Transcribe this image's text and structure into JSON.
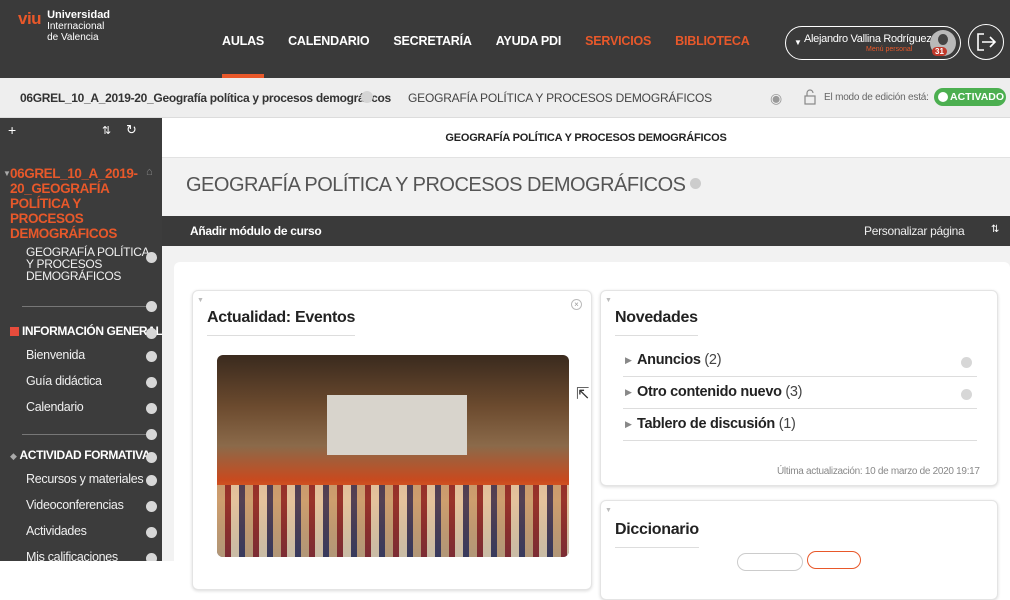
{
  "brand": {
    "mark": "viu",
    "line1": "Universidad",
    "line2": "Internacional",
    "line3": "de Valencia"
  },
  "nav": [
    {
      "label": "AULAS",
      "active": true,
      "color": "#ffffff"
    },
    {
      "label": "CALENDARIO",
      "color": "#ffffff"
    },
    {
      "label": "SECRETARÍA",
      "color": "#ffffff"
    },
    {
      "label": "AYUDA PDI",
      "color": "#ffffff"
    },
    {
      "label": "SERVICIOS",
      "color": "#e8582a"
    },
    {
      "label": "BIBLIOTECA",
      "color": "#e8582a"
    }
  ],
  "user": {
    "name": "Alejandro Vallina Rodríguez",
    "menu_label": "Menú personal",
    "badge": "31"
  },
  "breadcrumb": {
    "course_code": "06GREL_10_A_2019-20_Geografía política y procesos demográficos",
    "current": "GEOGRAFÍA POLÍTICA Y PROCESOS DEMOGRÁFICOS",
    "edit_mode_label": "El modo de edición está:",
    "edit_mode_state": "ACTIVADO"
  },
  "sidebar": {
    "tools": {
      "plus": "+",
      "sort": "⇅",
      "refresh": "↻"
    },
    "course_title": "06GREL_10_A_2019-20_GEOGRAFÍA POLÍTICA Y PROCESOS DEMOGRÁFICOS",
    "course_sub": "GEOGRAFÍA POLÍTICA Y PROCESOS DEMOGRÁFICOS",
    "section1": {
      "title": "INFORMACIÓN GENERAL",
      "items": [
        "Bienvenida",
        "Guía didáctica",
        "Calendario"
      ]
    },
    "section2": {
      "title": "ACTIVIDAD FORMATIVA",
      "items": [
        "Recursos y materiales",
        "Videoconferencias",
        "Actividades",
        "Mis calificaciones"
      ]
    }
  },
  "main": {
    "header": "GEOGRAFÍA POLÍTICA Y PROCESOS DEMOGRÁFICOS",
    "page_title": "GEOGRAFÍA POLÍTICA Y PROCESOS DEMOGRÁFICOS",
    "add_block": "Añadir módulo de curso",
    "customize": "Personalizar página",
    "sort_icon": "⇅"
  },
  "events_block": {
    "title": "Actualidad: Eventos"
  },
  "news_block": {
    "title": "Novedades",
    "items": [
      {
        "label": "Anuncios",
        "count": "(2)"
      },
      {
        "label": "Otro contenido nuevo",
        "count": "(3)"
      },
      {
        "label": "Tablero de discusión",
        "count": "(1)"
      }
    ],
    "last_update": "Última actualización: 10 de marzo de 2020 19:17"
  },
  "dictionary_block": {
    "title": "Diccionario"
  },
  "colors": {
    "accent": "#e8582a",
    "dark": "#3a3a3a",
    "toggle_on": "#4caf50"
  }
}
